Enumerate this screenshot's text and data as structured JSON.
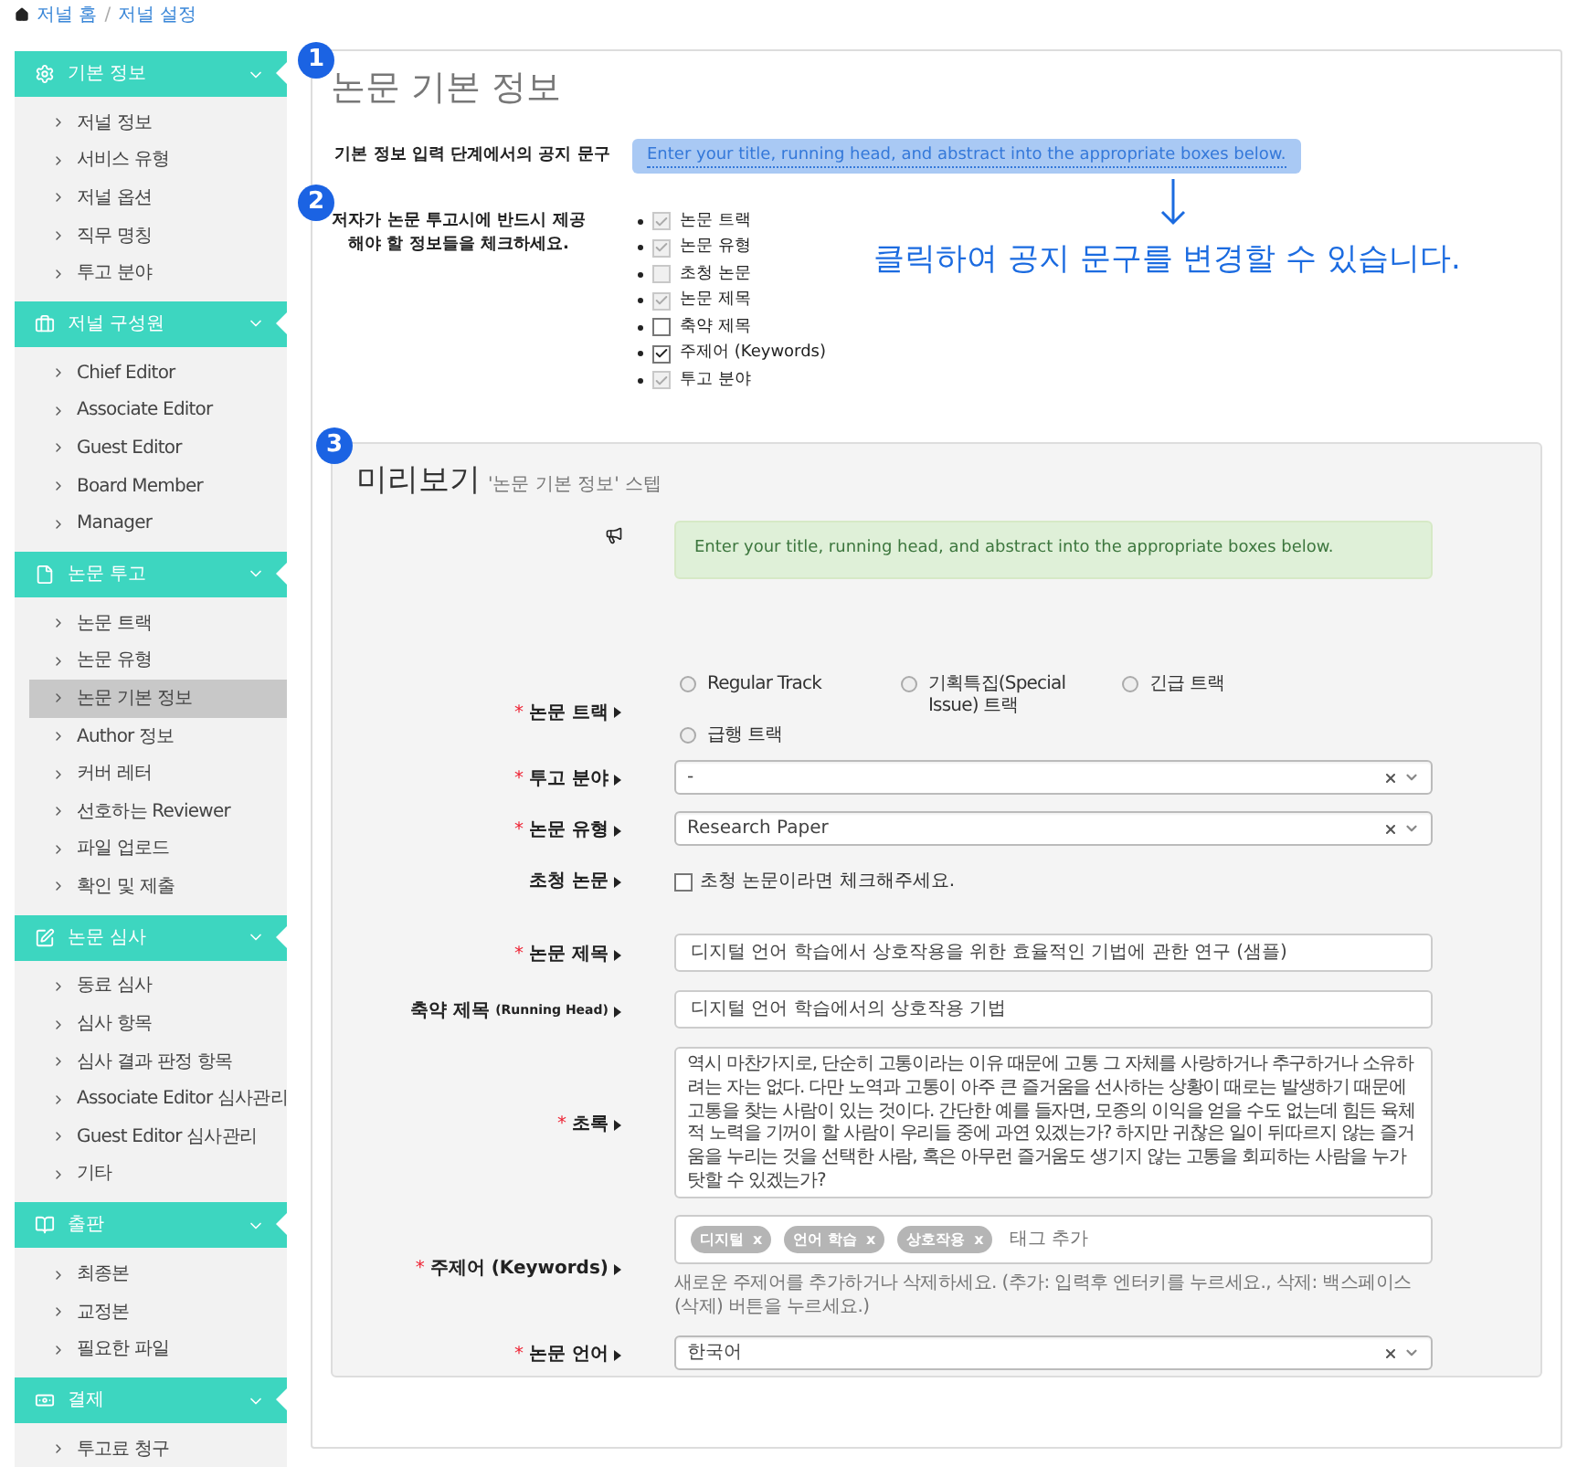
{
  "breadcrumb": [
    {
      "label": "저널 홈"
    },
    {
      "label": "/"
    },
    {
      "label": "저널 설정"
    }
  ],
  "sidebar": [
    {
      "title": "기본 정보",
      "items": [
        {
          "label": "저널 정보",
          "selected": false
        },
        {
          "label": "서비스 유형",
          "selected": false
        },
        {
          "label": "저널 옵션",
          "selected": false
        },
        {
          "label": "직무 명칭",
          "selected": false
        },
        {
          "label": "투고 분야",
          "selected": false
        }
      ]
    },
    {
      "title": "저널 구성원",
      "items": [
        {
          "label": "Chief Editor",
          "selected": false
        },
        {
          "label": "Associate Editor",
          "selected": false
        },
        {
          "label": "Guest Editor",
          "selected": false
        },
        {
          "label": "Board Member",
          "selected": false
        },
        {
          "label": "Manager",
          "selected": false
        }
      ]
    },
    {
      "title": "논문 투고",
      "items": [
        {
          "label": "논문 트랙",
          "selected": false
        },
        {
          "label": "논문 유형",
          "selected": false
        },
        {
          "label": "논문 기본 정보",
          "selected": true
        },
        {
          "label": "Author 정보",
          "selected": false
        },
        {
          "label": "커버 레터",
          "selected": false
        },
        {
          "label": "선호하는 Reviewer",
          "selected": false
        },
        {
          "label": "파일 업로드",
          "selected": false
        },
        {
          "label": "확인 및 제출",
          "selected": false
        }
      ]
    },
    {
      "title": "논문 심사",
      "items": [
        {
          "label": "동료 심사",
          "selected": false
        },
        {
          "label": "심사 항목",
          "selected": false
        },
        {
          "label": "심사 결과 판정 항목",
          "selected": false
        },
        {
          "label": "Associate Editor 심사관리",
          "selected": false
        },
        {
          "label": "Guest Editor 심사관리",
          "selected": false
        },
        {
          "label": "기타",
          "selected": false
        }
      ]
    },
    {
      "title": "출판",
      "items": [
        {
          "label": "최종본",
          "selected": false
        },
        {
          "label": "교정본",
          "selected": false
        },
        {
          "label": "필요한 파일",
          "selected": false
        }
      ]
    },
    {
      "title": "결제",
      "items": [
        {
          "label": "투고료 청구",
          "selected": false
        }
      ]
    }
  ],
  "step_badges": [
    "1",
    "2",
    "3"
  ],
  "page_title": "논문 기본 정보",
  "notice_setting": {
    "label": "기본 정보 입력 단계에서의 공지 문구",
    "value": "Enter your title, running head, and abstract into the appropriate boxes below."
  },
  "required_fields": {
    "label": "저자가 논문 투고시에 반드시 제공해야 할 정보들을 체크하세요.",
    "items": [
      {
        "label": "논문 트랙",
        "checked": true,
        "disabled": true
      },
      {
        "label": "논문 유형",
        "checked": true,
        "disabled": true
      },
      {
        "label": "초청 논문",
        "checked": false,
        "disabled": true
      },
      {
        "label": "논문 제목",
        "checked": true,
        "disabled": true
      },
      {
        "label": "축약 제목",
        "checked": false,
        "disabled": false
      },
      {
        "label": "주제어 (Keywords)",
        "checked": true,
        "disabled": false
      },
      {
        "label": "투고 분야",
        "checked": true,
        "disabled": true
      }
    ]
  },
  "required_mark": "*",
  "callout": "클릭하여 공지 문구를 변경할 수 있습니다.",
  "preview": {
    "title": "미리보기",
    "subtitle": "'논문 기본 정보' 스텝",
    "notice": "Enter your title, running head, and abstract into the appropriate boxes below.",
    "fields": [
      {
        "kind": "radio",
        "label": "논문 트랙",
        "required": true,
        "options": [
          {
            "label": "Regular Track",
            "selected": false
          },
          {
            "label": "기획특집(Special Issue) 트랙",
            "selected": false
          },
          {
            "label": "긴급 트랙",
            "selected": false
          },
          {
            "label": "급행 트랙",
            "selected": false
          }
        ]
      },
      {
        "kind": "select",
        "label": "투고 분야",
        "required": true,
        "value": "-"
      },
      {
        "kind": "select",
        "label": "논문 유형",
        "required": true,
        "value": "Research Paper"
      },
      {
        "kind": "checkbox",
        "label": "초청 논문",
        "required": false,
        "text": "초청 논문이라면 체크해주세요.",
        "checked": false
      },
      {
        "kind": "input",
        "label": "논문 제목",
        "required": true,
        "value": "디지털 언어 학습에서 상호작용을 위한 효율적인 기법에 관한 연구 (샘플)"
      },
      {
        "kind": "input",
        "label": "축약 제목",
        "label_note": "(Running Head)",
        "required": false,
        "value": "디지털 언어 학습에서의 상호작용 기법"
      },
      {
        "kind": "textarea",
        "label": "초록",
        "required": true,
        "value": "역시 마찬가지로, 단순히 고통이라는 이유 때문에 고통 그 자체를 사랑하거나 추구하거나 소유하려는 자는 없다. 다만 노역과 고통이 아주 큰 즐거움을 선사하는 상황이 때로는 발생하기 때문에 고통을 찾는 사람이 있는 것이다. 간단한 예를 들자면, 모종의 이익을 얻을 수도 없는데 힘든 육체적 노력을 기꺼이 할 사람이 우리들 중에 과연 있겠는가? 하지만 귀찮은 일이 뒤따르지 않는 즐거움을 누리는 것을 선택한 사람, 혹은 아무런 즐거움도 생기지 않는 고통을 회피하는 사람을 누가 탓할 수 있겠는가?"
      },
      {
        "kind": "tags",
        "label": "주제어 (Keywords)",
        "required": true,
        "tags": [
          {
            "label": "디지털",
            "remove": "x"
          },
          {
            "label": "언어 학습",
            "remove": "x"
          },
          {
            "label": "상호작용",
            "remove": "x"
          }
        ],
        "placeholder": "태그 추가",
        "help": "새로운 주제어를 추가하거나 삭제하세요. (추가: 입력후 엔터키를 누르세요., 삭제: 백스페이스(삭제) 버튼을 누르세요.)"
      },
      {
        "kind": "select",
        "label": "논문 언어",
        "required": true,
        "value": "한국어"
      }
    ]
  }
}
